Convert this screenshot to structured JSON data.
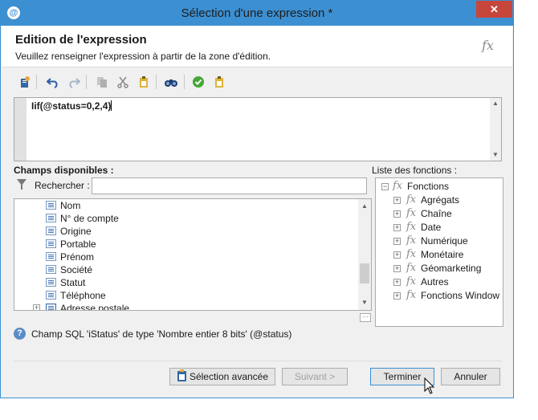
{
  "window": {
    "title": "Sélection d'une expression *",
    "close_label": "✕"
  },
  "header": {
    "title": "Edition de l'expression",
    "subtitle": "Veuillez renseigner l'expression à partir de la zone d'édition.",
    "icon": "fx"
  },
  "toolbar": {
    "icons": [
      "new-icon",
      "undo-icon",
      "redo-icon",
      "copy-icon",
      "cut-icon",
      "paste-icon",
      "find-icon",
      "validate-icon",
      "clipboard-icon"
    ]
  },
  "editor": {
    "expression": "Iif(@status=0,2,4)"
  },
  "fields_panel": {
    "title": "Champs disponibles :",
    "search_label": "Rechercher :",
    "search_value": "",
    "items": [
      {
        "label": "Nom"
      },
      {
        "label": "N° de compte"
      },
      {
        "label": "Origine"
      },
      {
        "label": "Portable"
      },
      {
        "label": "Prénom"
      },
      {
        "label": "Société"
      },
      {
        "label": "Statut"
      },
      {
        "label": "Téléphone"
      },
      {
        "label": "Adresse postale"
      }
    ]
  },
  "functions_panel": {
    "title": "Liste des fonctions :",
    "root": {
      "label": "Fonctions",
      "expander": "−"
    },
    "items": [
      {
        "label": "Agrégats"
      },
      {
        "label": "Chaîne"
      },
      {
        "label": "Date"
      },
      {
        "label": "Numérique"
      },
      {
        "label": "Monétaire"
      },
      {
        "label": "Géomarketing"
      },
      {
        "label": "Autres"
      },
      {
        "label": "Fonctions Window"
      }
    ],
    "expander": "+"
  },
  "status": {
    "text": "Champ SQL 'iStatus' de type 'Nombre entier 8 bits' (@status)",
    "help": "?"
  },
  "buttons": {
    "advanced": "Sélection avancée",
    "next": "Suivant >",
    "finish": "Terminer",
    "cancel": "Annuler"
  },
  "colors": {
    "titlebar": "#3c8fd1",
    "close": "#c7463c",
    "accent": "#3c8fd1"
  }
}
